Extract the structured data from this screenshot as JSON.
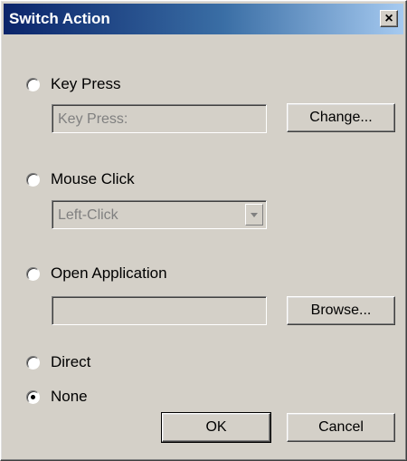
{
  "window": {
    "title": "Switch Action",
    "close_label": "×"
  },
  "options": {
    "key_press": {
      "label": "Key Press",
      "field_placeholder": "Key Press:",
      "button": "Change..."
    },
    "mouse_click": {
      "label": "Mouse Click",
      "selected": "Left-Click"
    },
    "open_application": {
      "label": "Open Application",
      "field_value": "",
      "button": "Browse..."
    },
    "direct": {
      "label": "Direct"
    },
    "none": {
      "label": "None",
      "checked": true
    }
  },
  "footer": {
    "ok": "OK",
    "cancel": "Cancel"
  }
}
